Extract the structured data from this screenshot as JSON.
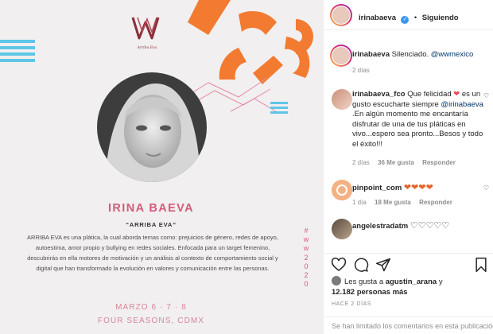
{
  "post": {
    "logo_tagline": "Arriba Eva",
    "speaker_name": "IRINA BAEVA",
    "talk_title": "“ARRIBA EVA”",
    "description": "ARRIBA EVA es una plática, la cual aborda temas como: prejuicios de género, redes de apoyo, autoestima, amor propio y bullying en redes sociales. Enfocada para un target femenino, descubrirás en ella motores de motivación y un análisis al contexto de comportamiento social y digital que han transformado la evolución en valores y comunicación entre las personas.",
    "dates": "MARZO 6 · 7 · 8",
    "venue": "FOUR SEASONS, CDMX",
    "hashtag_chars": [
      "#",
      "w",
      "w",
      "2",
      "0",
      "2",
      "0"
    ],
    "colors": {
      "accent_orange": "#f37a31",
      "accent_pink": "#d35c7c",
      "accent_blue": "#5fc6e7",
      "logo_maroon": "#8b2f3a"
    }
  },
  "header": {
    "username": "irinabaeva",
    "dot": "•",
    "follow_state": "Siguiendo",
    "verified": true
  },
  "comments": [
    {
      "username": "irinabaeva",
      "text": "Silenciado. @wwmexico",
      "mention": "@wwmexico",
      "time": "2 días",
      "likes": "",
      "has_reply": false
    },
    {
      "username": "irinabaeva_fco",
      "text_before": "Que felicidad ",
      "heart": "❤",
      "text_mid": " es un gusto escucharte siempre ",
      "mention": "@irinabaeva",
      "text_after": " .En algún momento me encantaría disfrutar de una de tus pláticas en vivo...espero sea pronto...Besos y todo el éxito!!!",
      "time": "2 días",
      "likes": "36 Me gusta",
      "reply_label": "Responder"
    },
    {
      "username": "pinpoint_com",
      "text": "❤❤❤❤",
      "time": "1 día",
      "likes": "18 Me gusta",
      "reply_label": "Responder"
    },
    {
      "username": "angelestradatm",
      "text": "♡♡♡♡♡",
      "time": "",
      "likes": ""
    }
  ],
  "likes_summary": {
    "prefix": "Les gusta a",
    "first_user": "agustin_arana",
    "connector": "y",
    "others": "12.182 personas más"
  },
  "timestamp": "HACE 2 DÍAS",
  "comment_bar": {
    "limited_text": "Se han limitado los comentarios en esta publicación."
  },
  "icons": [
    "heart-icon",
    "comment-icon",
    "share-icon",
    "bookmark-icon",
    "verified-badge-icon"
  ]
}
